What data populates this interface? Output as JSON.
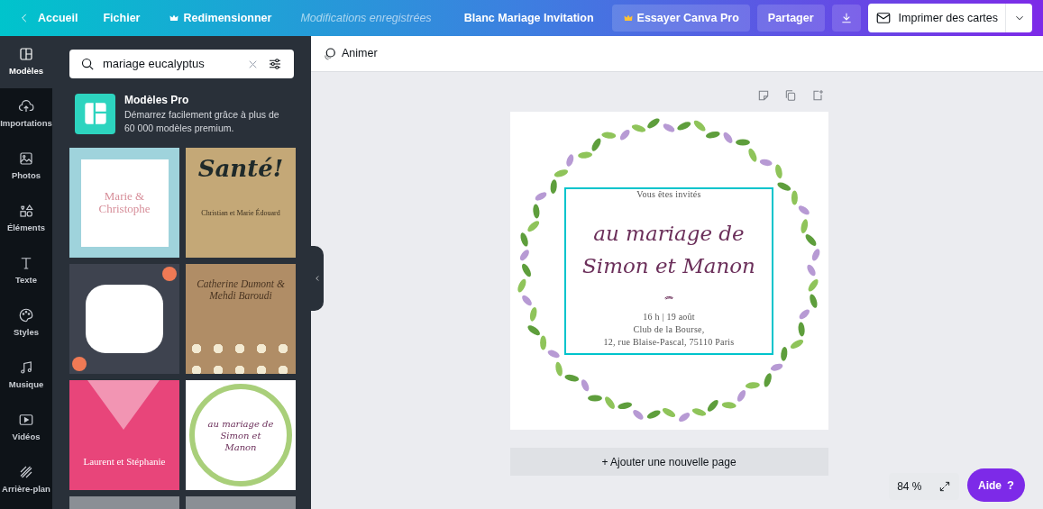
{
  "topbar": {
    "back": "Accueil",
    "menu": [
      {
        "label": "Fichier",
        "kind": "plain"
      },
      {
        "label": "Redimensionner",
        "kind": "crown"
      }
    ],
    "saved_status": "Modifications enregistrées",
    "document_title": "Blanc Mariage Invitation",
    "pro_button": "Essayer Canva Pro",
    "share_button": "Partager",
    "print_button": "Imprimer des cartes"
  },
  "sidebar": {
    "items": [
      {
        "label": "Modèles",
        "selected": true
      },
      {
        "label": "Importations",
        "selected": false
      },
      {
        "label": "Photos",
        "selected": false
      },
      {
        "label": "Éléments",
        "selected": false
      },
      {
        "label": "Texte",
        "selected": false
      },
      {
        "label": "Styles",
        "selected": false
      },
      {
        "label": "Musique",
        "selected": false
      },
      {
        "label": "Vidéos",
        "selected": false
      },
      {
        "label": "Arrière-plan",
        "selected": false
      }
    ]
  },
  "search": {
    "value": "mariage eucalyptus"
  },
  "pro_banner": {
    "title": "Modèles Pro",
    "description": "Démarrez facilement grâce à plus de 60 000 modèles premium."
  },
  "templates": [
    {
      "kind": "blue",
      "texts": [
        "Marie & Christophe"
      ]
    },
    {
      "kind": "gold",
      "texts": [
        "Santé!",
        "Christian et Marie Édouard"
      ]
    },
    {
      "kind": "floral"
    },
    {
      "kind": "kraft",
      "texts": [
        "Catherine Dumont & Mehdi Baroudi"
      ]
    },
    {
      "kind": "pink",
      "texts": [
        "Laurent et Stéphanie"
      ]
    },
    {
      "kind": "wreath",
      "texts": [
        "au mariage de Simon et Manon"
      ]
    },
    {
      "kind": "photo"
    },
    {
      "kind": "photo"
    }
  ],
  "canvas": {
    "animate": "Animer",
    "design": {
      "intro": "Vous êtes invités",
      "title_lines": [
        "au mariage de",
        "Simon et Manon"
      ],
      "details": [
        "16 h | 19 août",
        "Club de la Bourse,",
        "12, rue Blaise-Pascal, 75110 Paris"
      ],
      "selected": true
    },
    "add_page": "+ Ajouter une nouvelle page",
    "zoom": "84 %",
    "help": "Aide",
    "help_mark": "?"
  }
}
